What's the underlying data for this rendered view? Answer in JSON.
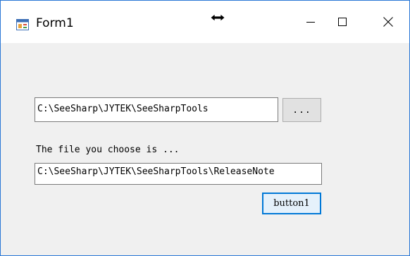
{
  "window": {
    "title": "Form1",
    "icons": {
      "app": "form-app-icon",
      "cursor": "horizontal-resize-cursor-icon",
      "minimize": "minimize-icon",
      "maximize": "maximize-icon",
      "close": "close-icon"
    }
  },
  "form": {
    "path_input_value": "C:\\SeeSharp\\JYTEK\\SeeSharpTools",
    "browse_button_label": "...",
    "file_label": "The file you choose is ...",
    "result_input_value": "C:\\SeeSharp\\JYTEK\\SeeSharpTools\\ReleaseNote",
    "action_button_label": "button1"
  },
  "colors": {
    "window_border": "#2b78d6",
    "client_background": "#f0f0f0",
    "focused_button_border": "#0078d7"
  }
}
